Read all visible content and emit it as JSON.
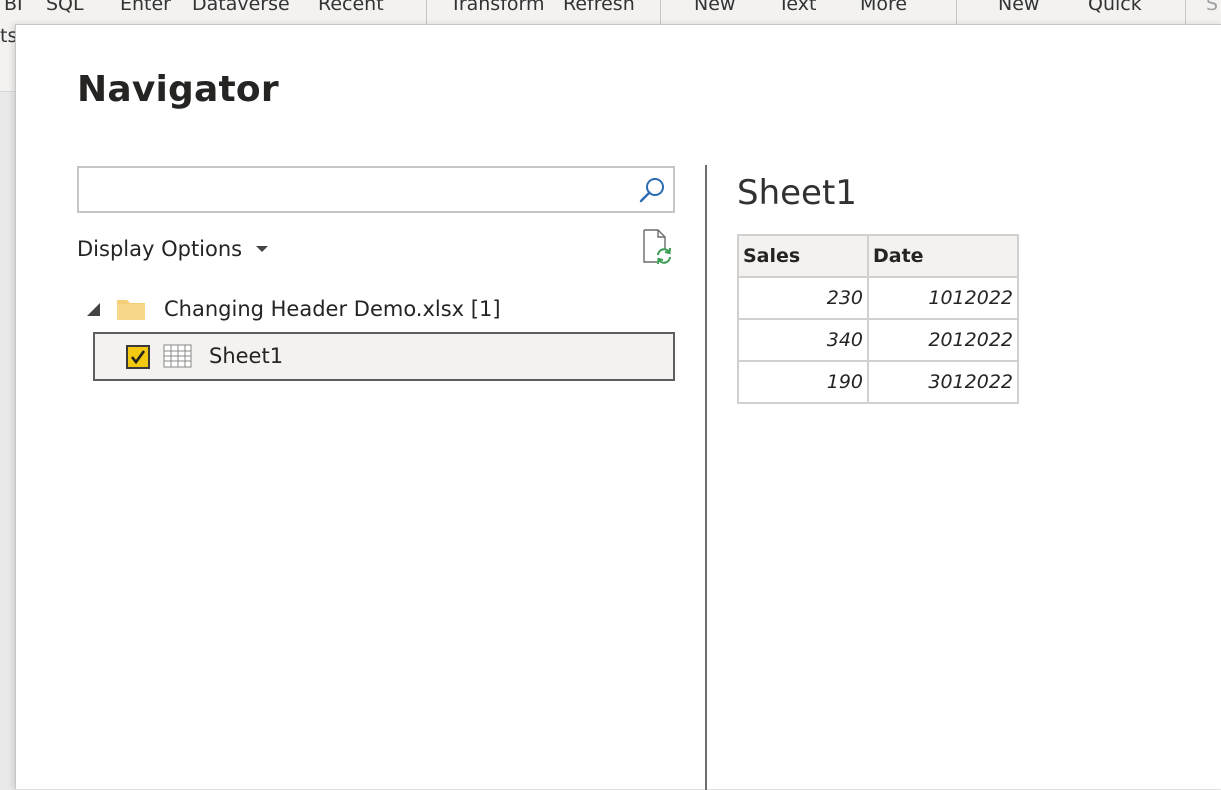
{
  "ribbon": {
    "items": [
      "BI",
      "SQL",
      "Enter",
      "Dataverse",
      "Recent",
      "Transform",
      "Refresh",
      "New",
      "Text",
      "More",
      "New",
      "Quick",
      "S"
    ],
    "cut_label": "ts"
  },
  "dialog": {
    "title": "Navigator"
  },
  "search": {
    "value": "",
    "placeholder": "",
    "icon": "search-icon"
  },
  "display_options": {
    "label": "Display Options"
  },
  "tree": {
    "root": {
      "label": "Changing Header Demo.xlsx [1]",
      "expanded": true,
      "icon": "folder-icon"
    },
    "items": [
      {
        "label": "Sheet1",
        "checked": true,
        "selected": true,
        "icon": "table-icon"
      }
    ]
  },
  "preview": {
    "title": "Sheet1",
    "columns": [
      "Sales",
      "Date"
    ],
    "rows": [
      [
        "230",
        "1012022"
      ],
      [
        "340",
        "2012022"
      ],
      [
        "190",
        "3012022"
      ]
    ]
  },
  "colors": {
    "checkbox_fill": "#f2c811",
    "folder": "#f5cf77",
    "selection_border": "#5e5e5e"
  }
}
